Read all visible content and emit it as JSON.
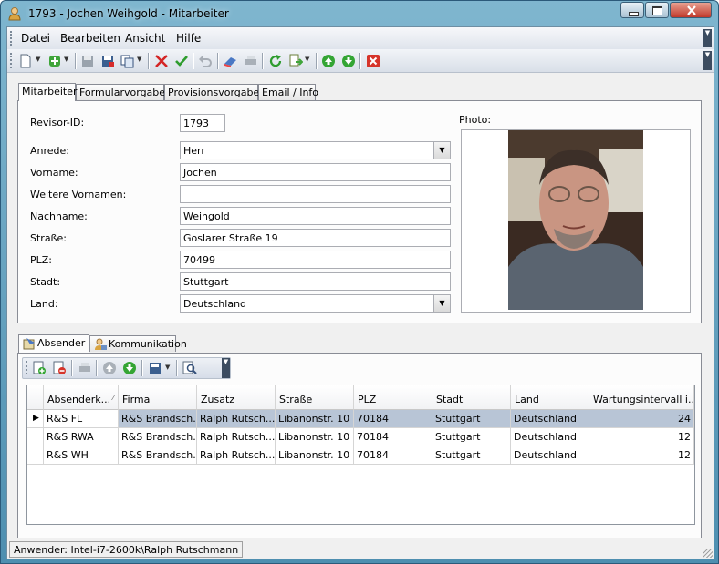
{
  "window": {
    "title": "1793 - Jochen Weihgold - Mitarbeiter"
  },
  "menu": {
    "items": [
      "Datei",
      "Bearbeiten",
      "Ansicht",
      "Hilfe"
    ]
  },
  "toolbar": {
    "icons": [
      "new-document-icon",
      "add-icon",
      "save-icon",
      "save-close-icon",
      "copy-icon",
      "delete-icon",
      "confirm-icon",
      "undo-icon",
      "eraser-icon",
      "print-icon",
      "refresh-icon",
      "export-icon",
      "move-up-icon",
      "move-down-icon",
      "close-record-icon"
    ]
  },
  "tabs": [
    {
      "label": "Mitarbeiter",
      "active": true
    },
    {
      "label": "Formularvorgaben",
      "active": false
    },
    {
      "label": "Provisionsvorgaben",
      "active": false
    },
    {
      "label": "Email / Info",
      "active": false
    }
  ],
  "form": {
    "revisor_id": {
      "label": "Revisor-ID:",
      "value": "1793"
    },
    "anrede": {
      "label": "Anrede:",
      "value": "Herr"
    },
    "vorname": {
      "label": "Vorname:",
      "value": "Jochen"
    },
    "weitere_vornamen": {
      "label": "Weitere Vornamen:",
      "value": ""
    },
    "nachname": {
      "label": "Nachname:",
      "value": "Weihgold"
    },
    "strasse": {
      "label": "Straße:",
      "value": "Goslarer Straße 19"
    },
    "plz": {
      "label": "PLZ:",
      "value": "70499"
    },
    "stadt": {
      "label": "Stadt:",
      "value": "Stuttgart"
    },
    "land": {
      "label": "Land:",
      "value": "Deutschland"
    },
    "photo_label": "Photo:"
  },
  "lower_tabs": [
    {
      "label": "Absender",
      "active": true,
      "icon": "sender-icon"
    },
    {
      "label": "Kommunikation",
      "active": false,
      "icon": "communication-icon"
    }
  ],
  "grid": {
    "columns": [
      "Absenderk...",
      "Firma",
      "Zusatz",
      "Straße",
      "PLZ",
      "Stadt",
      "Land",
      "Wartungsintervall i..."
    ],
    "rows": [
      [
        "R&S FL",
        "R&S Brandsch...",
        "Ralph Rutsch...",
        "Libanonstr. 10",
        "70184",
        "Stuttgart",
        "Deutschland",
        "24"
      ],
      [
        "R&S RWA",
        "R&S Brandsch...",
        "Ralph Rutsch...",
        "Libanonstr. 10",
        "70184",
        "Stuttgart",
        "Deutschland",
        "12"
      ],
      [
        "R&S WH",
        "R&S Brandsch...",
        "Ralph Rutsch...",
        "Libanonstr. 10",
        "70184",
        "Stuttgart",
        "Deutschland",
        "12"
      ]
    ],
    "selected_row": 0
  },
  "status": {
    "text": "Anwender: Intel-i7-2600k\\Ralph Rutschmann"
  },
  "colors": {
    "title_bar": "#5f9dbb",
    "selected_row": "#b8c5d6",
    "panel_bg": "#fcfcfc"
  }
}
